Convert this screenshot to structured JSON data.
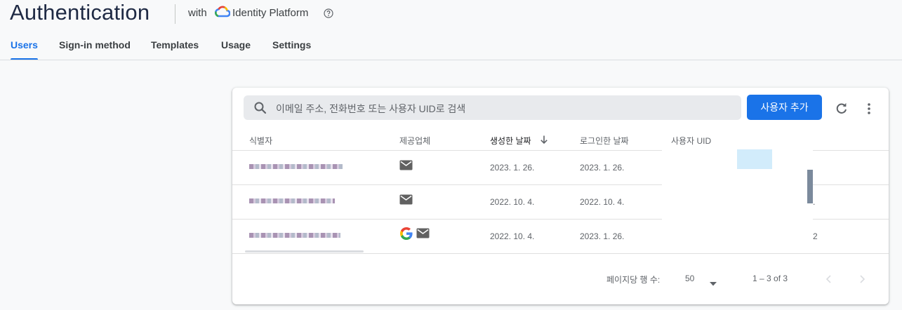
{
  "header": {
    "title": "Authentication",
    "with_label": "with",
    "platform_name": "Identity Platform"
  },
  "tabs": [
    {
      "label": "Users",
      "active": true
    },
    {
      "label": "Sign-in method",
      "active": false
    },
    {
      "label": "Templates",
      "active": false
    },
    {
      "label": "Usage",
      "active": false
    },
    {
      "label": "Settings",
      "active": false
    }
  ],
  "toolbar": {
    "search_placeholder": "이메일 주소, 전화번호 또는 사용자 UID로 검색",
    "add_user_label": "사용자 추가"
  },
  "table": {
    "columns": [
      "식별자",
      "제공업체",
      "생성한 날짜",
      "로그인한 날짜",
      "사용자 UID"
    ],
    "sorted_column": "생성한 날짜",
    "sort_direction": "descending",
    "rows": [
      {
        "identifier": "",
        "providers": [
          "mail-icon"
        ],
        "created": "2023. 1. 26.",
        "signed_in": "2023. 1. 26.",
        "uid_tail": ""
      },
      {
        "identifier": "",
        "providers": [
          "mail-icon"
        ],
        "created": "2022. 10. 4.",
        "signed_in": "2022. 10. 4.",
        "uid_tail": "."
      },
      {
        "identifier": "",
        "providers": [
          "google-icon",
          "mail-icon"
        ],
        "created": "2022. 10. 4.",
        "signed_in": "2023. 1. 26.",
        "uid_tail": "2"
      }
    ]
  },
  "pagination": {
    "rows_per_page_label": "페이지당 행 수:",
    "rows_per_page_value": "50",
    "range_text": "1 – 3 of 3"
  },
  "colors": {
    "accent": "#1a73e8",
    "title": "#1f2a44",
    "background": "#f8f9fa"
  }
}
